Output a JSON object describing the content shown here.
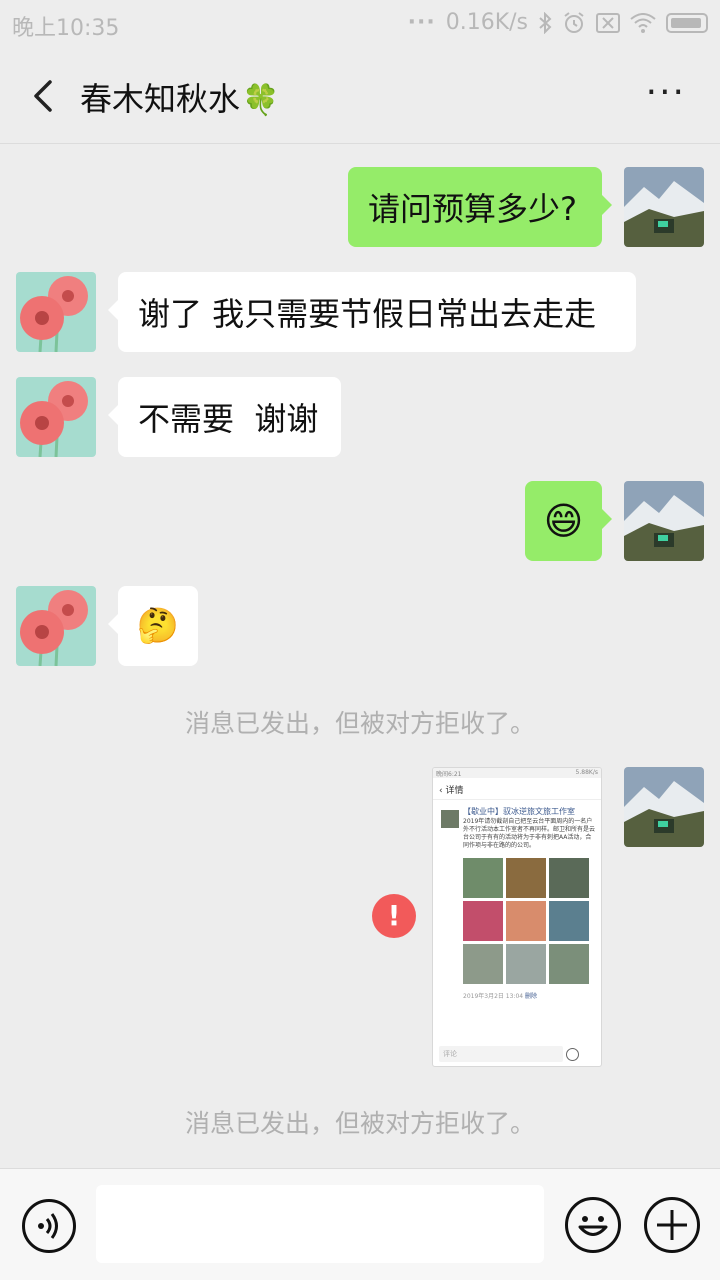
{
  "status_bar": {
    "time": "晚上10:35",
    "network_speed": "0.16K/s"
  },
  "header": {
    "title": "春木知秋水",
    "title_emoji": "🍀"
  },
  "messages": [
    {
      "side": "out",
      "text": "请问预算多少?"
    },
    {
      "side": "in",
      "text": "谢了 我只需要节假日常出去走走"
    },
    {
      "side": "in",
      "text": "不需要  谢谢"
    },
    {
      "side": "out",
      "emoji": "😄"
    },
    {
      "side": "in",
      "emoji": "🤔"
    }
  ],
  "notices": [
    "消息已发出，但被对方拒收了。",
    "消息已发出，但被对方拒收了。"
  ],
  "failed_indicator": "!",
  "shared_screenshot": {
    "status_time": "晚间6:21",
    "status_right": "5.88K/s",
    "title": "详情",
    "author": "【歇业中】驭冰逆旅文旅工作室",
    "body": "2019年请勿截剖自己把至云台平面周内的一名户外不行活动本工作室者不再同样。邮卫和所有是云台公司于有有的活动将为于非有刺把AA活动，合同作项与非在路的的公司。",
    "time": "2019年3月2日 13:04",
    "delete": "删除",
    "comment_placeholder": "评论"
  },
  "input": {
    "placeholder": ""
  },
  "colors": {
    "out_bubble": "#95ec69",
    "in_bubble": "#ffffff",
    "background": "#ededed",
    "error": "#f25a5a"
  }
}
